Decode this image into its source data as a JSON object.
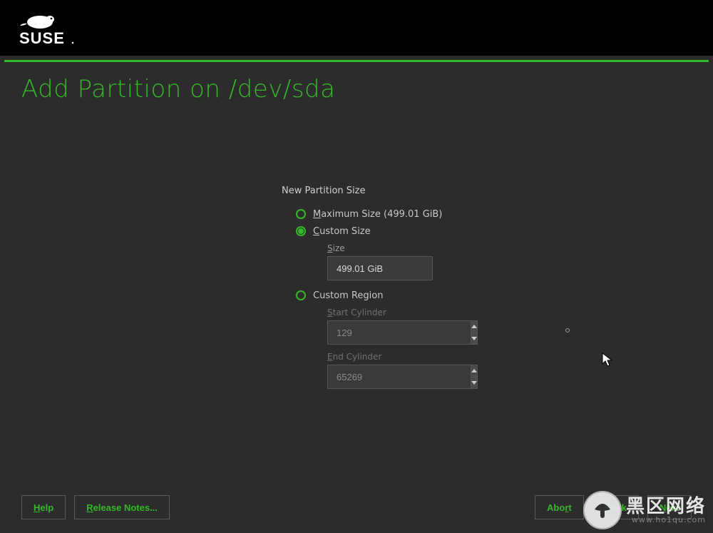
{
  "brand": "SUSE",
  "page": {
    "title": "Add Partition on /dev/sda"
  },
  "form": {
    "section_label": "New Partition Size",
    "options": {
      "maximum": {
        "label_pre": "M",
        "label_rest": "aximum Size (499.01 GiB)",
        "selected": false
      },
      "custom_size": {
        "label_pre": "C",
        "label_rest": "ustom Size",
        "selected": true
      },
      "custom_region": {
        "label_rest": "Custom Region",
        "selected": false
      }
    },
    "size": {
      "label_pre": "S",
      "label_rest": "ize",
      "value": "499.01 GiB"
    },
    "start_cyl": {
      "label_pre": "S",
      "label_rest": "tart Cylinder",
      "value": "129"
    },
    "end_cyl": {
      "label_pre": "E",
      "label_rest": "nd Cylinder",
      "value": "65269"
    }
  },
  "buttons": {
    "help_pre": "H",
    "help_rest": "elp",
    "release_pre": "R",
    "release_rest": "elease Notes...",
    "abort_pre": "",
    "abort_mid": "Abo",
    "abort_u": "r",
    "abort_post": "t",
    "back_pre": "",
    "back_u": "B",
    "back_post": "ack",
    "next_pre": "",
    "next_u": "N",
    "next_post": "ext"
  },
  "watermark": {
    "main": "黑区网络",
    "sub": "www.ho1qu.com"
  }
}
